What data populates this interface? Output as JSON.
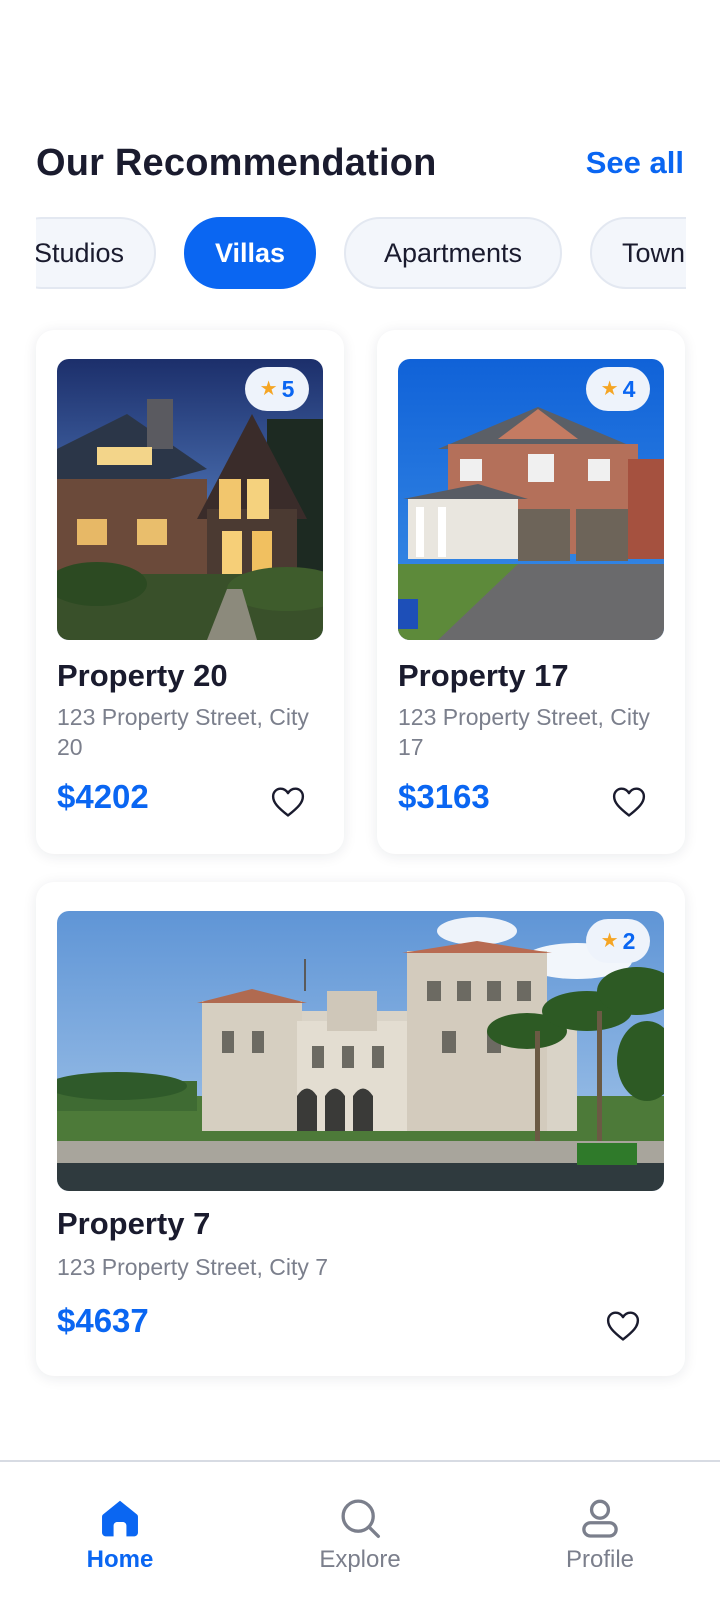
{
  "header": {
    "title": "Our Recommendation",
    "see_all": "See all"
  },
  "categories": [
    {
      "label": "Studios",
      "active": false
    },
    {
      "label": "Villas",
      "active": true
    },
    {
      "label": "Apartments",
      "active": false
    },
    {
      "label": "Town",
      "active": false
    }
  ],
  "properties": [
    {
      "title": "Property 20",
      "address": "123 Property Street, City 20",
      "price": "$4202",
      "rating": "5",
      "image": "house-at-dusk-photo"
    },
    {
      "title": "Property 17",
      "address": "123 Property Street, City 17",
      "price": "$3163",
      "rating": "4",
      "image": "brick-house-photo"
    },
    {
      "title": "Property 7",
      "address": "123 Property Street, City 7",
      "price": "$4637",
      "rating": "2",
      "image": "waterfront-mansion-photo"
    }
  ],
  "nav": {
    "items": [
      {
        "label": "Home",
        "icon": "home-icon",
        "active": true
      },
      {
        "label": "Explore",
        "icon": "search-icon",
        "active": false
      },
      {
        "label": "Profile",
        "icon": "user-icon",
        "active": false
      }
    ]
  },
  "colors": {
    "accent": "#0a66f2",
    "star": "#f5a524",
    "text_dark": "#1a1b2e",
    "text_muted": "#7b7f8c"
  }
}
